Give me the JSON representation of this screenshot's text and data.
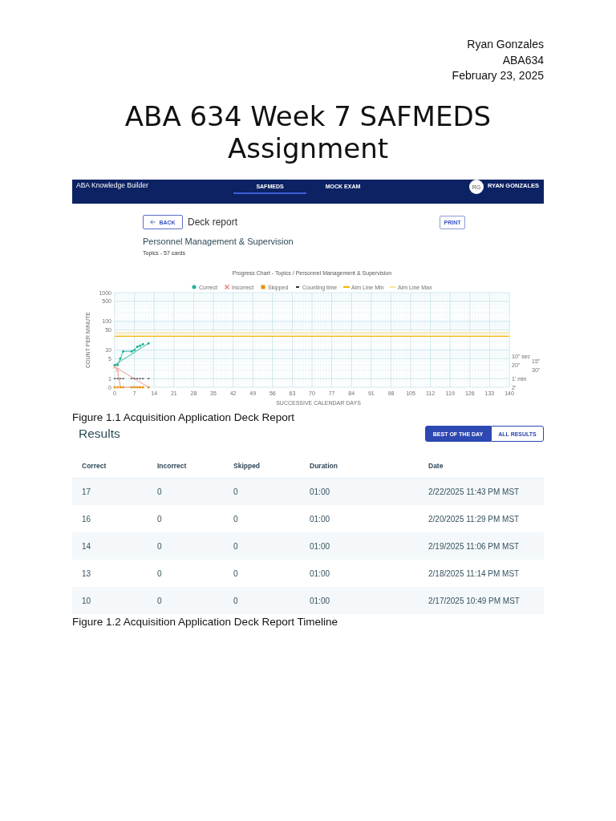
{
  "document_header": {
    "author": "Ryan Gonzales",
    "course": "ABA634",
    "date": "February 23, 2025"
  },
  "title": "ABA 634 Week 7 SAFMEDS Assignment",
  "deck_report_screenshot": {
    "app_bar": {
      "brand": "ABA Knowledge Builder",
      "tabs": [
        {
          "label": "SAFMEDS",
          "selected": true
        },
        {
          "label": "MOCK EXAM",
          "selected": false
        }
      ],
      "avatar_initials": "RG",
      "user_name": "RYAN GONZALES"
    },
    "back_button": "BACK",
    "page_title": "Deck report",
    "print_button": "PRINT",
    "deck_name": "Personnel Management & Supervision",
    "deck_info": "Topics - 57 cards",
    "progress_chart": {
      "title": "Progress Chart - Topics / Personnel Management & Supervision",
      "legend": [
        {
          "label": "Correct",
          "color": "#1db394",
          "kind": "circle"
        },
        {
          "label": "Incorrect",
          "color": "#f08a7e",
          "kind": "cross"
        },
        {
          "label": "Skipped",
          "color": "#e8920f",
          "kind": "square"
        },
        {
          "label": "Counting time",
          "color": "#333333",
          "kind": "dot"
        },
        {
          "label": "Aim Line Min",
          "color": "#f2b400",
          "kind": "line"
        },
        {
          "label": "Aim Line Max",
          "color": "#f8e4a2",
          "kind": "line"
        }
      ],
      "y_axis_title": "COUNT PER MINUTE",
      "y_tick_labels": [
        "1000",
        "500",
        "100",
        "50",
        "10",
        "5",
        "1",
        "0"
      ],
      "x_tick_labels": [
        "0",
        "7",
        "14",
        "21",
        "28",
        "35",
        "42",
        "49",
        "56",
        "63",
        "70",
        "77",
        "84",
        "91",
        "98",
        "105",
        "112",
        "119",
        "126",
        "133",
        "140"
      ],
      "x_axis_title": "SUCCESSIVE CALENDAR DAYS",
      "right_axis_labels": [
        "10\" sec",
        "15\"",
        "20\"",
        "30\"",
        "1' min",
        "2'"
      ]
    }
  },
  "figure_1_caption": "Figure 1.1 Acquisition Application Deck Report",
  "results_screenshot": {
    "heading": "Results",
    "filters": [
      {
        "label": "BEST OF THE DAY",
        "selected": true
      },
      {
        "label": "ALL RESULTS",
        "selected": false
      }
    ],
    "table": {
      "columns": [
        "Correct",
        "Incorrect",
        "Skipped",
        "Duration",
        "Date"
      ],
      "rows": [
        [
          "17",
          "0",
          "0",
          "01:00",
          "2/22/2025 11:43 PM MST"
        ],
        [
          "16",
          "0",
          "0",
          "01:00",
          "2/20/2025 11:29 PM MST"
        ],
        [
          "14",
          "0",
          "0",
          "01:00",
          "2/19/2025 11:06 PM MST"
        ],
        [
          "13",
          "0",
          "0",
          "01:00",
          "2/18/2025 11:14 PM MST"
        ],
        [
          "10",
          "0",
          "0",
          "01:00",
          "2/17/2025 10:49 PM MST"
        ]
      ]
    }
  },
  "figure_2_caption": "Figure 1.2 Acquisition Application Deck Report Timeline"
}
